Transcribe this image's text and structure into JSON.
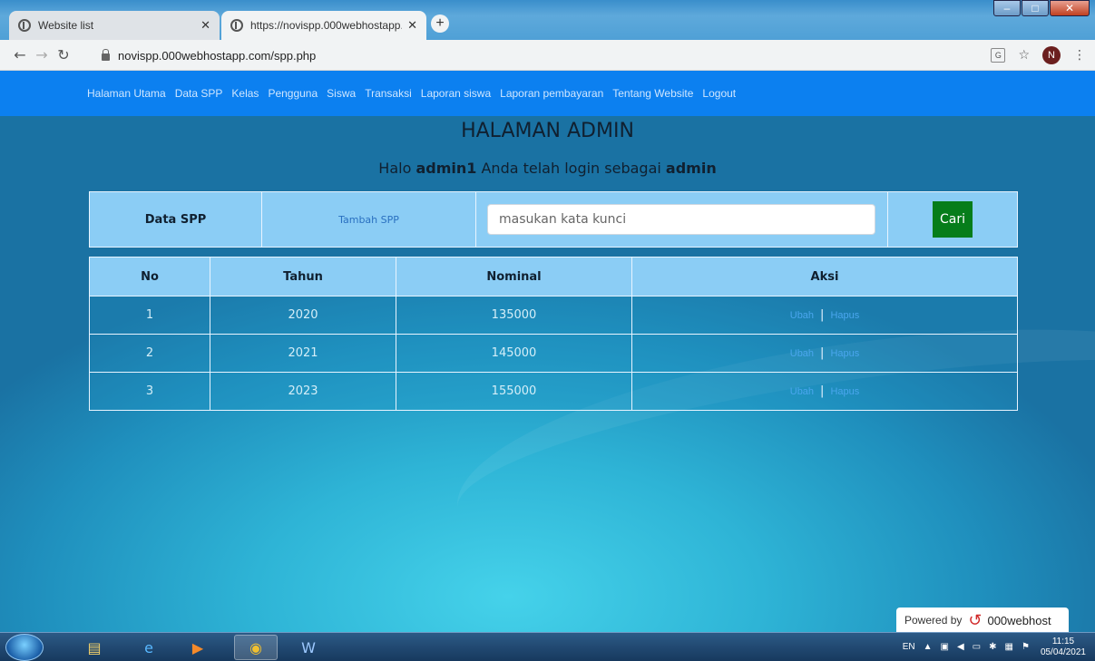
{
  "browser": {
    "tabs": [
      {
        "title": "Website list",
        "active": false
      },
      {
        "title": "https://novispp.000webhostapp.",
        "active": true
      }
    ],
    "new_tab_symbol": "+",
    "url": "novispp.000webhostapp.com/spp.php",
    "profile_initial": "N"
  },
  "nav": {
    "items": [
      "Halaman Utama",
      "Data SPP",
      "Kelas",
      "Pengguna",
      "Siswa",
      "Transaksi",
      "Laporan siswa",
      "Laporan pembayaran",
      "Tentang Website",
      "Logout"
    ]
  },
  "page": {
    "title": "HALAMAN ADMIN",
    "greeting_prefix": "Halo",
    "greeting_user": "admin1",
    "greeting_middle": "Anda telah login sebagai",
    "greeting_role": "admin"
  },
  "toolbar": {
    "label": "Data SPP",
    "add_link": "Tambah SPP",
    "search_placeholder": "masukan kata kunci",
    "search_button": "Cari"
  },
  "table": {
    "headers": [
      "No",
      "Tahun",
      "Nominal",
      "Aksi"
    ],
    "rows": [
      {
        "no": "1",
        "tahun": "2020",
        "nominal": "135000"
      },
      {
        "no": "2",
        "tahun": "2021",
        "nominal": "145000"
      },
      {
        "no": "3",
        "tahun": "2023",
        "nominal": "155000"
      }
    ],
    "edit_label": "Ubah",
    "delete_label": "Hapus",
    "separator": "|"
  },
  "footer_badge": {
    "powered_by": "Powered by",
    "brand": "000webhost"
  },
  "taskbar": {
    "language": "EN",
    "time": "11:15",
    "date": "05/04/2021"
  }
}
